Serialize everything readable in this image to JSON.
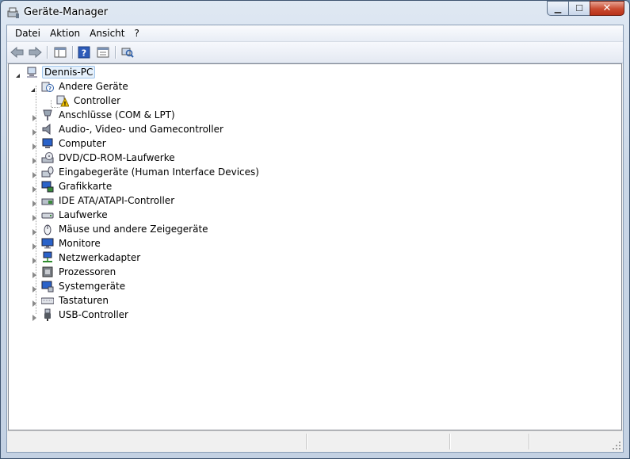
{
  "window": {
    "title": "Geräte-Manager"
  },
  "caption": {
    "minimize": "▁",
    "maximize": "☐",
    "close": "✕"
  },
  "menu": [
    "Datei",
    "Aktion",
    "Ansicht",
    "?"
  ],
  "toolbar": [
    "back-icon",
    "forward-icon",
    "show-hide-console-tree-icon",
    "help-icon",
    "properties-icon",
    "scan-hardware-icon"
  ],
  "tree": {
    "root": "Dennis-PC",
    "categories": [
      {
        "label": "Andere Geräte",
        "icon": "unknown-device-icon",
        "expanded": true,
        "children": [
          "Controller"
        ]
      },
      {
        "label": "Anschlüsse (COM & LPT)",
        "icon": "port-icon"
      },
      {
        "label": "Audio-, Video- und Gamecontroller",
        "icon": "speaker-icon"
      },
      {
        "label": "Computer",
        "icon": "computer-icon"
      },
      {
        "label": "DVD/CD-ROM-Laufwerke",
        "icon": "dvd-drive-icon"
      },
      {
        "label": "Eingabegeräte (Human Interface Devices)",
        "icon": "hid-icon"
      },
      {
        "label": "Grafikkarte",
        "icon": "display-adapter-icon"
      },
      {
        "label": "IDE ATA/ATAPI-Controller",
        "icon": "ide-controller-icon"
      },
      {
        "label": "Laufwerke",
        "icon": "disk-drive-icon"
      },
      {
        "label": "Mäuse und andere Zeigegeräte",
        "icon": "mouse-icon"
      },
      {
        "label": "Monitore",
        "icon": "monitor-icon"
      },
      {
        "label": "Netzwerkadapter",
        "icon": "network-adapter-icon"
      },
      {
        "label": "Prozessoren",
        "icon": "processor-icon"
      },
      {
        "label": "Systemgeräte",
        "icon": "system-device-icon"
      },
      {
        "label": "Tastaturen",
        "icon": "keyboard-icon"
      },
      {
        "label": "USB-Controller",
        "icon": "usb-icon"
      }
    ]
  }
}
